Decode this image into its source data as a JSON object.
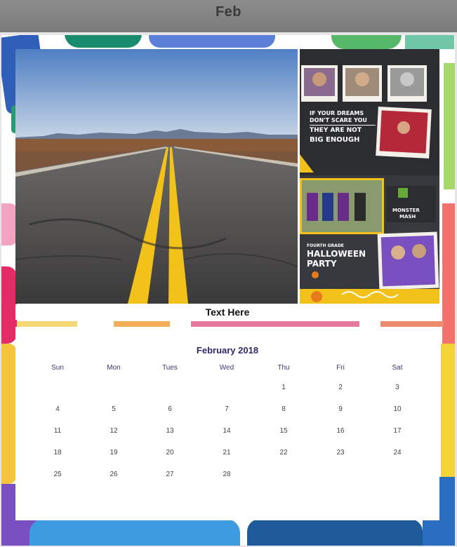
{
  "header": {
    "title": "Feb"
  },
  "photo": {
    "caption": "Text Here"
  },
  "collage": {
    "quote_line1": "IF YOUR DREAMS",
    "quote_line2": "DON'T SCARE YOU",
    "quote_line3": "THEY ARE NOT",
    "quote_line4": "BIG ENOUGH",
    "grade_line": "FOURTH GRADE",
    "party_line1": "HALLOWEEN",
    "party_line2": "PARTY",
    "badge_line": "MONSTER",
    "badge_line2": "MASH"
  },
  "calendar": {
    "title": "February 2018",
    "weekdays": [
      "Sun",
      "Mon",
      "Tues",
      "Wed",
      "Thu",
      "Fri",
      "Sat"
    ],
    "weeks": [
      [
        "",
        "",
        "",
        "",
        "1",
        "2",
        "3"
      ],
      [
        "4",
        "5",
        "6",
        "7",
        "8",
        "9",
        "10"
      ],
      [
        "11",
        "12",
        "13",
        "14",
        "15",
        "16",
        "17"
      ],
      [
        "18",
        "19",
        "20",
        "21",
        "22",
        "23",
        "24"
      ],
      [
        "25",
        "26",
        "27",
        "28",
        "",
        "",
        ""
      ]
    ]
  },
  "colors": {
    "title_bar": "#808080",
    "calendar_text": "#2d2a6a",
    "road_line": "#f2c21b"
  }
}
